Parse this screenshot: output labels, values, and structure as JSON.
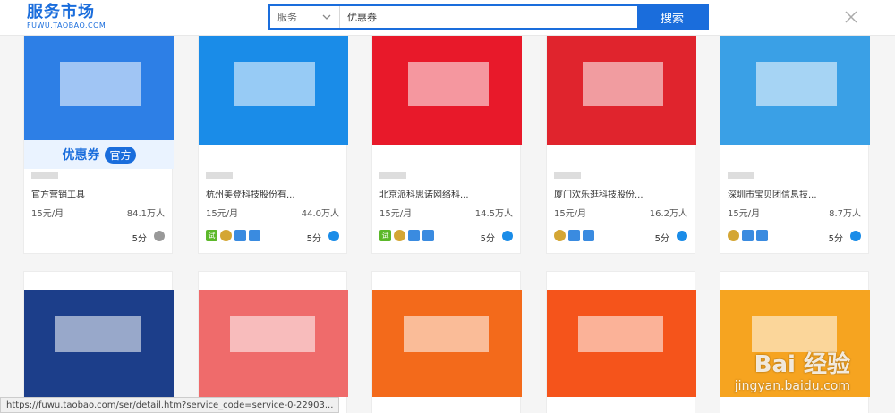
{
  "header": {
    "logo_main": "服务市场",
    "logo_sub": "FUWU.TAOBAO.COM",
    "search_category": "服务",
    "search_value": "优惠券",
    "search_button": "搜索"
  },
  "cards": [
    {
      "name": "官方营销工具",
      "price": "15元/月",
      "users": "84.1万人",
      "score": "5分",
      "banner_color": "#2d7fe6",
      "badge_text": "优惠券",
      "badge_tag": "官方",
      "badges": []
    },
    {
      "name": "杭州美登科技股份有...",
      "price": "15元/月",
      "users": "44.0万人",
      "score": "5分",
      "banner_color": "#1a8ce8",
      "badges": [
        "试",
        "铜",
        "蓝",
        "蓝"
      ]
    },
    {
      "name": "北京派科思诺网络科...",
      "price": "15元/月",
      "users": "14.5万人",
      "score": "5分",
      "banner_color": "#e8192a",
      "badges": [
        "试",
        "铜",
        "蓝",
        "蓝"
      ]
    },
    {
      "name": "厦门欢乐逛科技股份...",
      "price": "15元/月",
      "users": "16.2万人",
      "score": "5分",
      "banner_color": "#e0242d",
      "badges": [
        "铜",
        "蓝",
        "蓝"
      ]
    },
    {
      "name": "深圳市宝贝团信息技...",
      "price": "15元/月",
      "users": "8.7万人",
      "score": "5分",
      "banner_color": "#3aa0e6",
      "badges": [
        "铜",
        "蓝",
        "蓝"
      ]
    }
  ],
  "cards_row2": [
    {
      "banner_color": "#1c3e8a"
    },
    {
      "banner_color": "#ef6b6b"
    },
    {
      "banner_color": "#f36a1b"
    },
    {
      "banner_color": "#f5541b"
    },
    {
      "banner_color": "#f6a420"
    }
  ],
  "status_bar": "https://fuwu.taobao.com/ser/detail.htm?service_code=service-0-22903...",
  "watermark": {
    "main": "Bai 经验",
    "sub": "jingyan.baidu.com"
  }
}
